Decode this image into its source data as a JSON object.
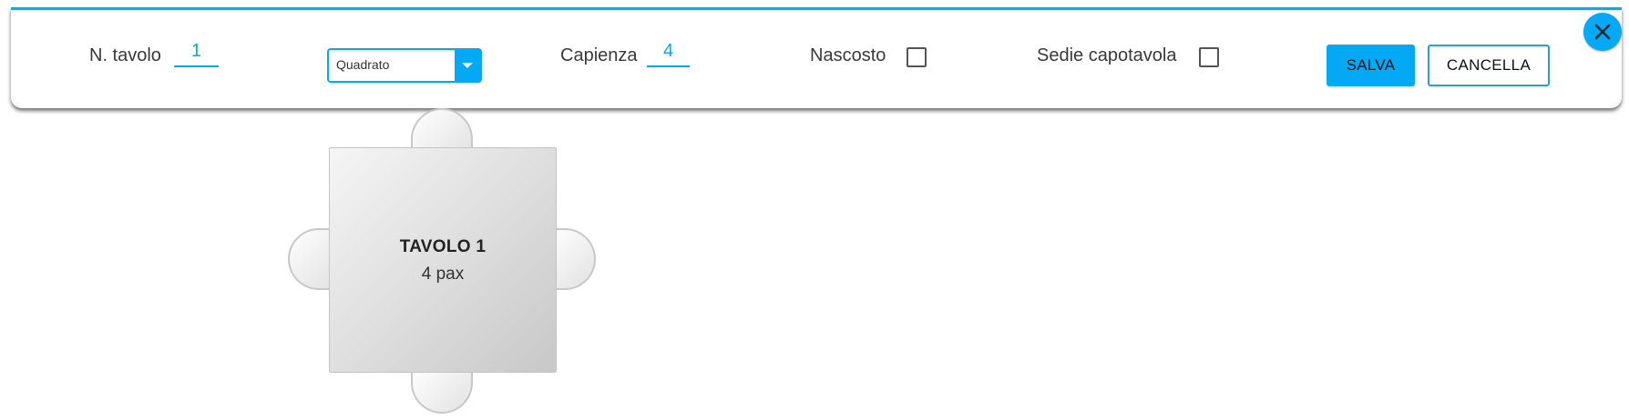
{
  "toolbar": {
    "table_number_label": "N. tavolo",
    "table_number_value": "1",
    "shape_select": {
      "selected": "Quadrato"
    },
    "capacity_label": "Capienza",
    "capacity_value": "4",
    "hidden_label": "Nascosto",
    "hidden_checked": false,
    "head_chairs_label": "Sedie capotavola",
    "head_chairs_checked": false,
    "save_label": "SALVA",
    "cancel_label": "CANCELLA",
    "close_icon": "close-icon"
  },
  "colors": {
    "accent": "#03a9f4",
    "toolbar_border": "#2a9fd6"
  },
  "floor": {
    "table": {
      "name": "TAVOLO 1",
      "pax": "4 pax",
      "shape": "square",
      "chairs": [
        "top",
        "right",
        "bottom",
        "left"
      ]
    }
  }
}
